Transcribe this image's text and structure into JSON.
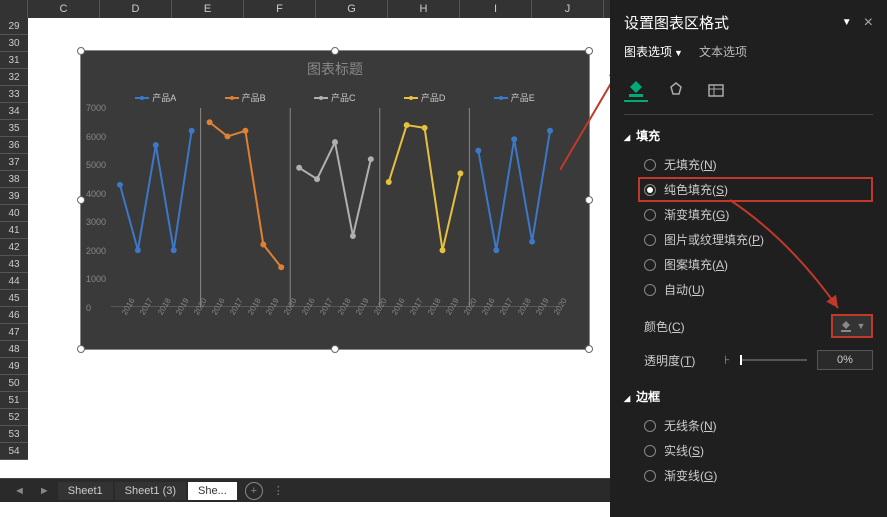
{
  "columns": [
    "C",
    "D",
    "E",
    "F",
    "G",
    "H",
    "I",
    "J"
  ],
  "rows": [
    29,
    30,
    31,
    32,
    33,
    34,
    35,
    36,
    37,
    38,
    39,
    40,
    41,
    42,
    43,
    44,
    45,
    46,
    47,
    48,
    49,
    50,
    51,
    52,
    53,
    54
  ],
  "sheets": {
    "items": [
      "Sheet1",
      "Sheet1 (3)",
      "She..."
    ],
    "active_index": 2
  },
  "chart_data": {
    "type": "line",
    "title": "图表标题",
    "ylim": [
      0,
      7000
    ],
    "y_ticks": [
      0,
      1000,
      2000,
      3000,
      4000,
      5000,
      6000,
      7000
    ],
    "categories": [
      "2016",
      "2017",
      "2018",
      "2019",
      "2020",
      "2016",
      "2017",
      "2018",
      "2019",
      "2020",
      "2016",
      "2017",
      "2018",
      "2019",
      "2020",
      "2016",
      "2017",
      "2018",
      "2019",
      "2020",
      "2016",
      "2017",
      "2018",
      "2019",
      "2020"
    ],
    "series": [
      {
        "name": "产品A",
        "color": "#3c78c8",
        "values": [
          4300,
          2000,
          5700,
          2000,
          6200,
          null,
          null,
          null,
          null,
          null,
          null,
          null,
          null,
          null,
          null,
          null,
          null,
          null,
          null,
          null,
          null,
          null,
          null,
          null,
          null
        ]
      },
      {
        "name": "产品B",
        "color": "#e08030",
        "values": [
          null,
          null,
          null,
          null,
          null,
          6500,
          6000,
          6200,
          2200,
          1400,
          null,
          null,
          null,
          null,
          null,
          null,
          null,
          null,
          null,
          null,
          null,
          null,
          null,
          null,
          null
        ]
      },
      {
        "name": "产品C",
        "color": "#b0b0b0",
        "values": [
          null,
          null,
          null,
          null,
          null,
          null,
          null,
          null,
          null,
          null,
          4900,
          4500,
          5800,
          2500,
          5200,
          null,
          null,
          null,
          null,
          null,
          null,
          null,
          null,
          null,
          null
        ]
      },
      {
        "name": "产品D",
        "color": "#e8c040",
        "values": [
          null,
          null,
          null,
          null,
          null,
          null,
          null,
          null,
          null,
          null,
          null,
          null,
          null,
          null,
          null,
          4400,
          6400,
          6300,
          2000,
          4700,
          null,
          null,
          null,
          null,
          null
        ]
      },
      {
        "name": "产品E",
        "color": "#3c78c8",
        "values": [
          null,
          null,
          null,
          null,
          null,
          null,
          null,
          null,
          null,
          null,
          null,
          null,
          null,
          null,
          null,
          null,
          null,
          null,
          null,
          null,
          5500,
          2000,
          5900,
          2300,
          6200
        ]
      }
    ]
  },
  "panel": {
    "title": "设置图表区格式",
    "option_tabs": {
      "chart": "图表选项",
      "text": "文本选项"
    },
    "sections": {
      "fill": {
        "title": "填充",
        "options": {
          "none": "无填充(N)",
          "solid": "纯色填充(S)",
          "gradient": "渐变填充(G)",
          "picture": "图片或纹理填充(P)",
          "pattern": "图案填充(A)",
          "auto": "自动(U)"
        },
        "selected": "solid",
        "color_label": "颜色(C)",
        "transparency_label": "透明度(T)",
        "transparency_value": "0%"
      },
      "border": {
        "title": "边框",
        "options": {
          "none": "无线条(N)",
          "solid": "实线(S)",
          "gradient": "渐变线(G)"
        }
      }
    }
  }
}
